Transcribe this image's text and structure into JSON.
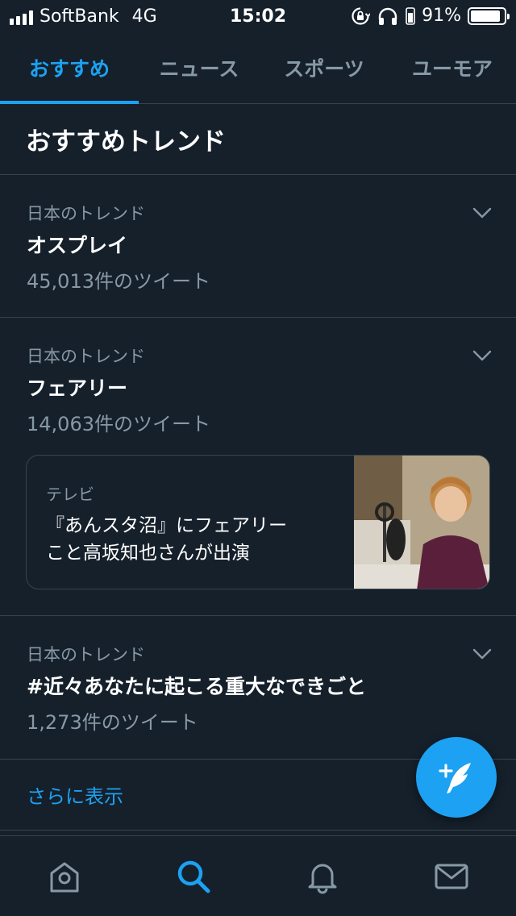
{
  "status_bar": {
    "carrier": "SoftBank",
    "network": "4G",
    "time": "15:02",
    "battery_text": "91%",
    "battery_level": 0.91
  },
  "tabs": [
    {
      "label": "おすすめ",
      "active": true
    },
    {
      "label": "ニュース",
      "active": false
    },
    {
      "label": "スポーツ",
      "active": false
    },
    {
      "label": "ユーモア",
      "active": false
    }
  ],
  "section": {
    "title": "おすすめトレンド"
  },
  "trends": [
    {
      "context": "日本のトレンド",
      "name": "オスプレイ",
      "count": "45,013件のツイート"
    },
    {
      "context": "日本のトレンド",
      "name": "フェアリー",
      "count": "14,063件のツイート",
      "card": {
        "category": "テレビ",
        "headline_line1": "『あんスタ沼』にフェアリー",
        "headline_line2": "こと高坂知也さんが出演"
      }
    },
    {
      "context": "日本のトレンド",
      "name": "#近々あなたに起こる重大なできごと",
      "count": "1,273件のツイート"
    }
  ],
  "show_more": "さらに表示",
  "colors": {
    "background": "#15202b",
    "accent": "#1da1f2",
    "divider": "#38444d",
    "secondary_text": "#8899a6"
  },
  "icons": {
    "compose": "compose-tweet-icon",
    "nav": [
      "home-icon",
      "search-icon",
      "notifications-icon",
      "messages-icon"
    ]
  }
}
